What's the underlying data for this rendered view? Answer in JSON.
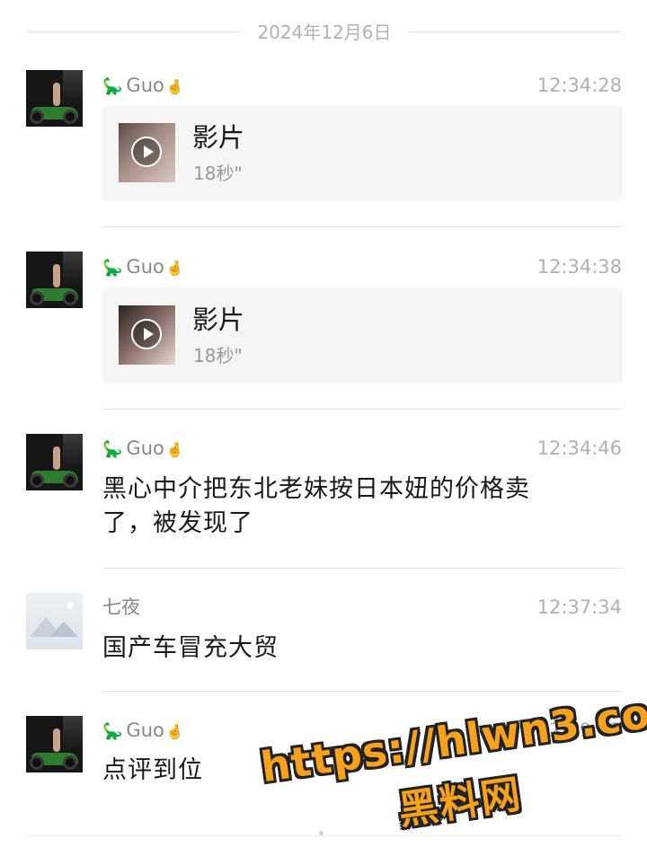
{
  "date_separator": "2024年12月6日",
  "messages": [
    {
      "sender": "Guo",
      "time": "12:34:28",
      "type": "video",
      "video": {
        "title": "影片",
        "duration": "18秒\""
      }
    },
    {
      "sender": "Guo",
      "time": "12:34:38",
      "type": "video",
      "video": {
        "title": "影片",
        "duration": "18秒\""
      }
    },
    {
      "sender": "Guo",
      "time": "12:34:46",
      "type": "text",
      "text_line1": "黑心中介把东北老妹按日本妞的价格卖",
      "text_line2": "了，被发现了"
    },
    {
      "sender": "七夜",
      "time": "12:37:34",
      "type": "text",
      "text_line1": "国产车冒充大贸"
    },
    {
      "sender": "Guo",
      "time": "12:39:47",
      "type": "text",
      "text_line1": "点评到位"
    }
  ],
  "icons": {
    "name_prefix": "dinosaur-emoji",
    "name_suffix": "crossed-fingers-emoji"
  },
  "watermark": {
    "url": "https://hlwn3.com",
    "name": "黑料网"
  }
}
